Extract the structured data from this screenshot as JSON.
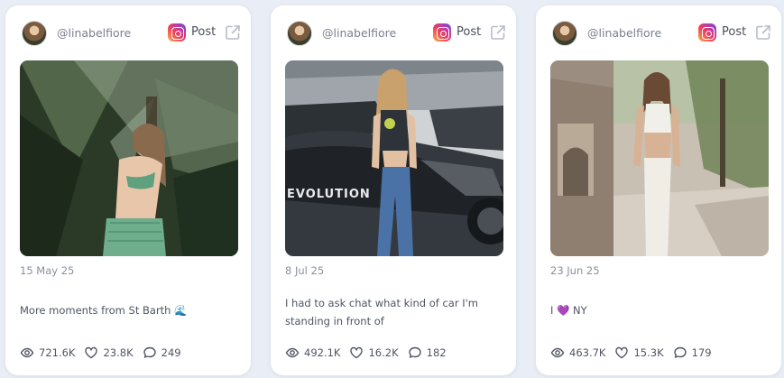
{
  "posts": [
    {
      "handle": "@linabelfiore",
      "post_label": "Post",
      "date": "15 May 25",
      "caption": "More moments from St Barth 🌊",
      "views": "721.6K",
      "likes": "23.8K",
      "comments": "249"
    },
    {
      "handle": "@linabelfiore",
      "post_label": "Post",
      "date": "8 Jul 25",
      "caption": "I had to ask chat what kind of car I'm standing in front of",
      "views": "492.1K",
      "likes": "16.2K",
      "comments": "182"
    },
    {
      "handle": "@linabelfiore",
      "post_label": "Post",
      "date": "23 Jun 25",
      "caption": "I 💜 NY",
      "views": "463.7K",
      "likes": "15.3K",
      "comments": "179"
    }
  ],
  "icons": {
    "platform": "instagram-icon",
    "external": "external-link-icon",
    "views": "eye-icon",
    "likes": "heart-icon",
    "comments": "comment-icon"
  },
  "colors": {
    "background": "#e9edf5",
    "card": "#ffffff",
    "muted_text": "#8a90a0",
    "body_text": "#4f5564"
  }
}
